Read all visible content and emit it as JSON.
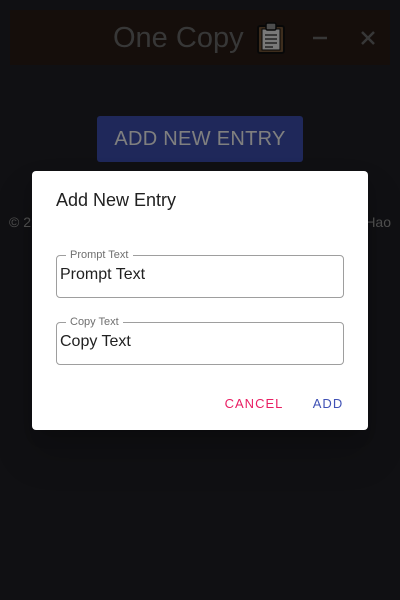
{
  "titlebar": {
    "title": "One Copy",
    "icon": "clipboard-icon",
    "minimize_icon": "minimize-icon",
    "close_icon": "close-icon"
  },
  "main": {
    "add_entry_label": "ADD NEW ENTRY",
    "footer_left": "© 2",
    "footer_right": "Hao"
  },
  "dialog": {
    "title": "Add New Entry",
    "prompt_field": {
      "label": "Prompt Text",
      "value": "Prompt Text"
    },
    "copy_field": {
      "label": "Copy Text",
      "value": "Copy Text"
    },
    "cancel_label": "CANCEL",
    "add_label": "ADD"
  },
  "colors": {
    "background": "#202126",
    "titlebar": "#2b1d17",
    "primary": "#3f51b5",
    "secondary": "#e91e63"
  }
}
